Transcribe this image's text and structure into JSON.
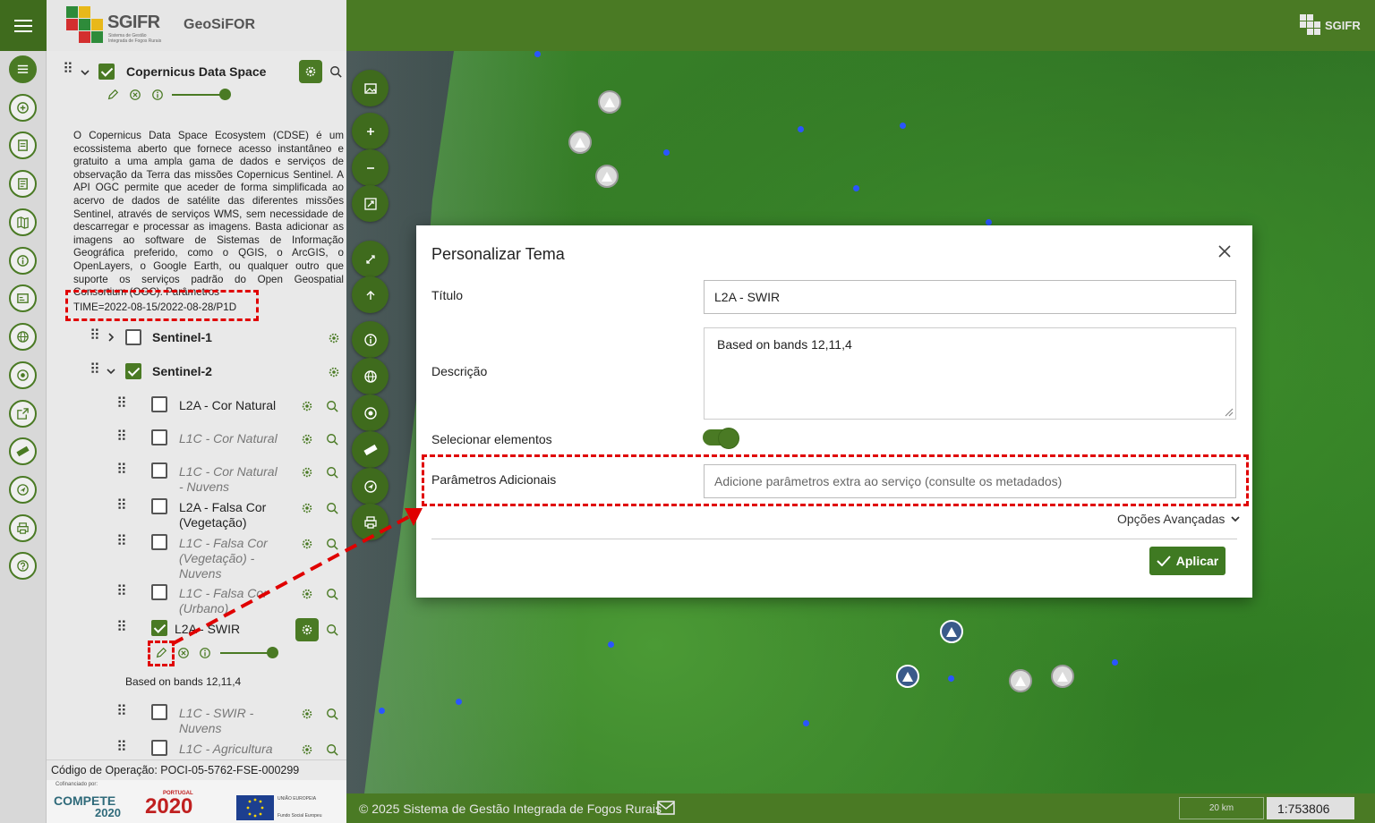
{
  "header": {
    "logo_text": "SGIFR",
    "logo_sub": "Sistema de Gestão Integrada de Fogos Rurais",
    "app_name": "GeoSiFOR",
    "right_logo_text": "SGIFR"
  },
  "rail": {
    "items": [
      "layers-icon",
      "add-layer-icon",
      "legend-icon",
      "document-icon",
      "map-icon",
      "info-icon",
      "card-icon",
      "globe-icon",
      "target-icon",
      "export-icon",
      "ruler-icon",
      "location-icon",
      "print-icon",
      "help-icon"
    ]
  },
  "panel": {
    "group_title": "Copernicus Data Space",
    "description": "O Copernicus Data Space Ecosystem (CDSE) é um ecossistema aberto que fornece acesso instantâneo e gratuito a uma ampla gama de dados e serviços de observação da Terra das missões Copernicus Sentinel. A API OGC permite que aceder de forma simplificada ao acervo de dados de satélite das diferentes missões Sentinel, através de serviços WMS, sem necessidade de descarregar e processar as imagens. Basta adicionar as imagens ao software de Sistemas de Informação Geográfica preferido, como o QGIS, o ArcGIS, o OpenLayers, o Google Earth, ou qualquer outro que suporte os serviços padrão do Open Geospatial Consortium (OGC). Parâmetros",
    "time_param": "TIME=2022-08-15/2022-08-28/P1D",
    "sentinel1": "Sentinel-1",
    "sentinel2": "Sentinel-2",
    "layers": [
      {
        "label": "L2A - Cor Natural",
        "checked": false,
        "italic": false
      },
      {
        "label": "L1C - Cor Natural",
        "checked": false,
        "italic": true
      },
      {
        "label": "L1C - Cor Natural - Nuvens",
        "checked": false,
        "italic": true
      },
      {
        "label": "L2A - Falsa Cor (Vegetação)",
        "checked": false,
        "italic": false
      },
      {
        "label": "L1C - Falsa Cor (Vegetação) - Nuvens",
        "checked": false,
        "italic": true
      },
      {
        "label": "L1C - Falsa Cor (Urbano)",
        "checked": false,
        "italic": true
      },
      {
        "label": "L2A - SWIR",
        "checked": true,
        "italic": false
      },
      {
        "label": "L1C - SWIR - Nuvens",
        "checked": false,
        "italic": true
      },
      {
        "label": "L1C - Agricultura",
        "checked": false,
        "italic": true
      }
    ],
    "swir_description": "Based on bands 12,11,4",
    "operation_code": "Código de Operação: POCI-05-5762-FSE-000299",
    "fund_logos": {
      "cofin": "Cofinanciado por:",
      "compete": "COMPETE",
      "compete_year": "2020",
      "portugal": "PORTUGAL",
      "portugal_year": "2020",
      "eu": "UNIÃO EUROPEIA",
      "eu_sub": "Fundo Social Europeu"
    }
  },
  "map_tools": [
    "image-icon",
    "zoom-in-icon",
    "zoom-out-icon",
    "fit-extent-icon",
    "collapse-icon",
    "upload-icon",
    "info-icon",
    "globe-icon",
    "target-icon",
    "ruler-icon",
    "location-icon",
    "print-icon"
  ],
  "footer": {
    "copyright": "© 2025 Sistema de Gestão Integrada de Fogos Rurais",
    "scale_label": "20 km",
    "ratio": "1:753806"
  },
  "modal": {
    "title": "Personalizar Tema",
    "titulo_label": "Título",
    "titulo_value": "L2A - SWIR",
    "descricao_label": "Descrição",
    "descricao_value": "Based on bands 12,11,4",
    "selecionar_label": "Selecionar elementos",
    "parametros_label": "Parâmetros Adicionais",
    "parametros_placeholder": "Adicione parâmetros extra ao serviço (consulte os metadados)",
    "advanced_label": "Opções Avançadas",
    "apply_label": "Aplicar"
  },
  "colors": {
    "accent": "#4a7a24",
    "highlight": "#e00000"
  }
}
